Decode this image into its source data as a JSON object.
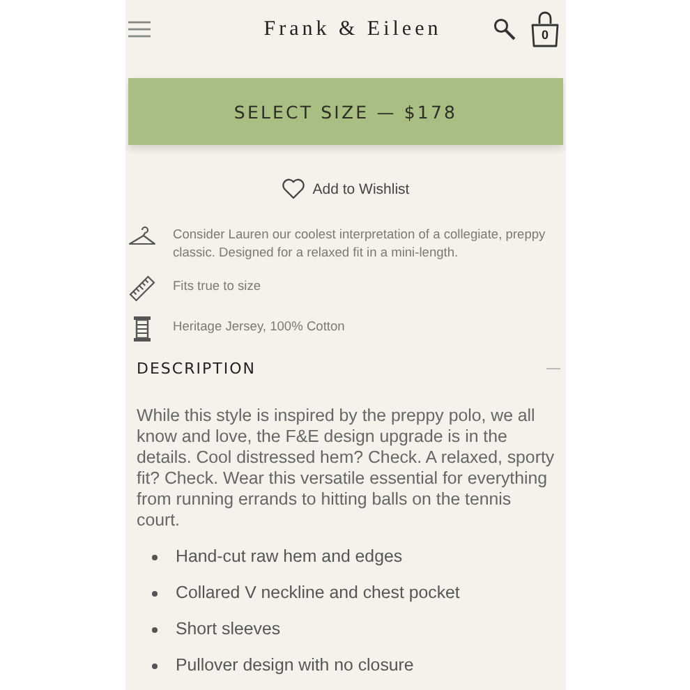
{
  "header": {
    "logo": "Frank & Eileen",
    "cart_count": "0"
  },
  "buy_button": {
    "label": "SELECT SIZE — $178"
  },
  "wishlist": {
    "label": "Add to Wishlist"
  },
  "features": [
    {
      "kind": "hanger",
      "text": "Consider Lauren our coolest interpretation of a collegiate, preppy classic. Designed for a relaxed fit in a mini-length."
    },
    {
      "kind": "ruler",
      "text": "Fits true to size"
    },
    {
      "kind": "spool",
      "text": "Heritage Jersey, 100% Cotton"
    }
  ],
  "description": {
    "title": "DESCRIPTION",
    "expanded": true,
    "text": "While this style is inspired by the preppy polo, we all know and love, the F&E design upgrade is in the details. Cool distressed hem? Check. A relaxed, sporty fit? Check. Wear this versatile essential for everything from running errands to hitting balls on the tennis court.",
    "bullets": [
      "Hand-cut raw hem and edges",
      "Collared V neckline and chest pocket",
      "Short sleeves",
      "Pullover design with no closure"
    ]
  }
}
